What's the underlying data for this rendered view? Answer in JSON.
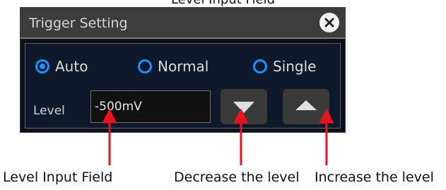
{
  "caption_top": "Level Input Field",
  "dialog": {
    "title": "Trigger Setting",
    "modes": [
      {
        "label": "Auto",
        "selected": true
      },
      {
        "label": "Normal",
        "selected": false
      },
      {
        "label": "Single",
        "selected": false
      }
    ],
    "level_label": "Level",
    "level_value": "-500mV"
  },
  "annotations": {
    "input_field": "Level Input Field",
    "decrease": "Decrease the level",
    "increase": "Increase the level"
  },
  "colors": {
    "accent": "#1e90ff",
    "annotation": "#e8141b"
  }
}
